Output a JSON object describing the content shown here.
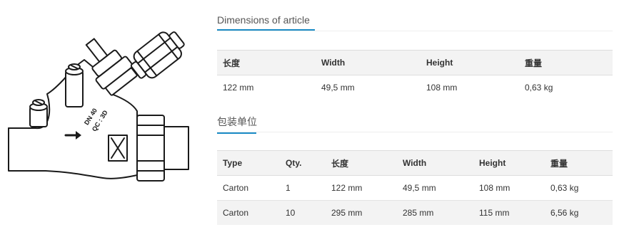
{
  "dimensions": {
    "title": "Dimensions of article",
    "headers": [
      "长度",
      "Width",
      "Height",
      "重量"
    ],
    "row": [
      "122 mm",
      "49,5 mm",
      "108 mm",
      "0,63 kg"
    ]
  },
  "packaging": {
    "title": "包装单位",
    "headers": [
      "Type",
      "Qty.",
      "长度",
      "Width",
      "Height",
      "重量"
    ],
    "rows": [
      [
        "Carton",
        "1",
        "122 mm",
        "49,5 mm",
        "108 mm",
        "0,63 kg"
      ],
      [
        "Carton",
        "10",
        "295 mm",
        "285 mm",
        "115 mm",
        "6,56 kg"
      ]
    ]
  },
  "illustration": {
    "body_marking_1": "DN 40",
    "body_marking_2": "QC : 3D"
  }
}
